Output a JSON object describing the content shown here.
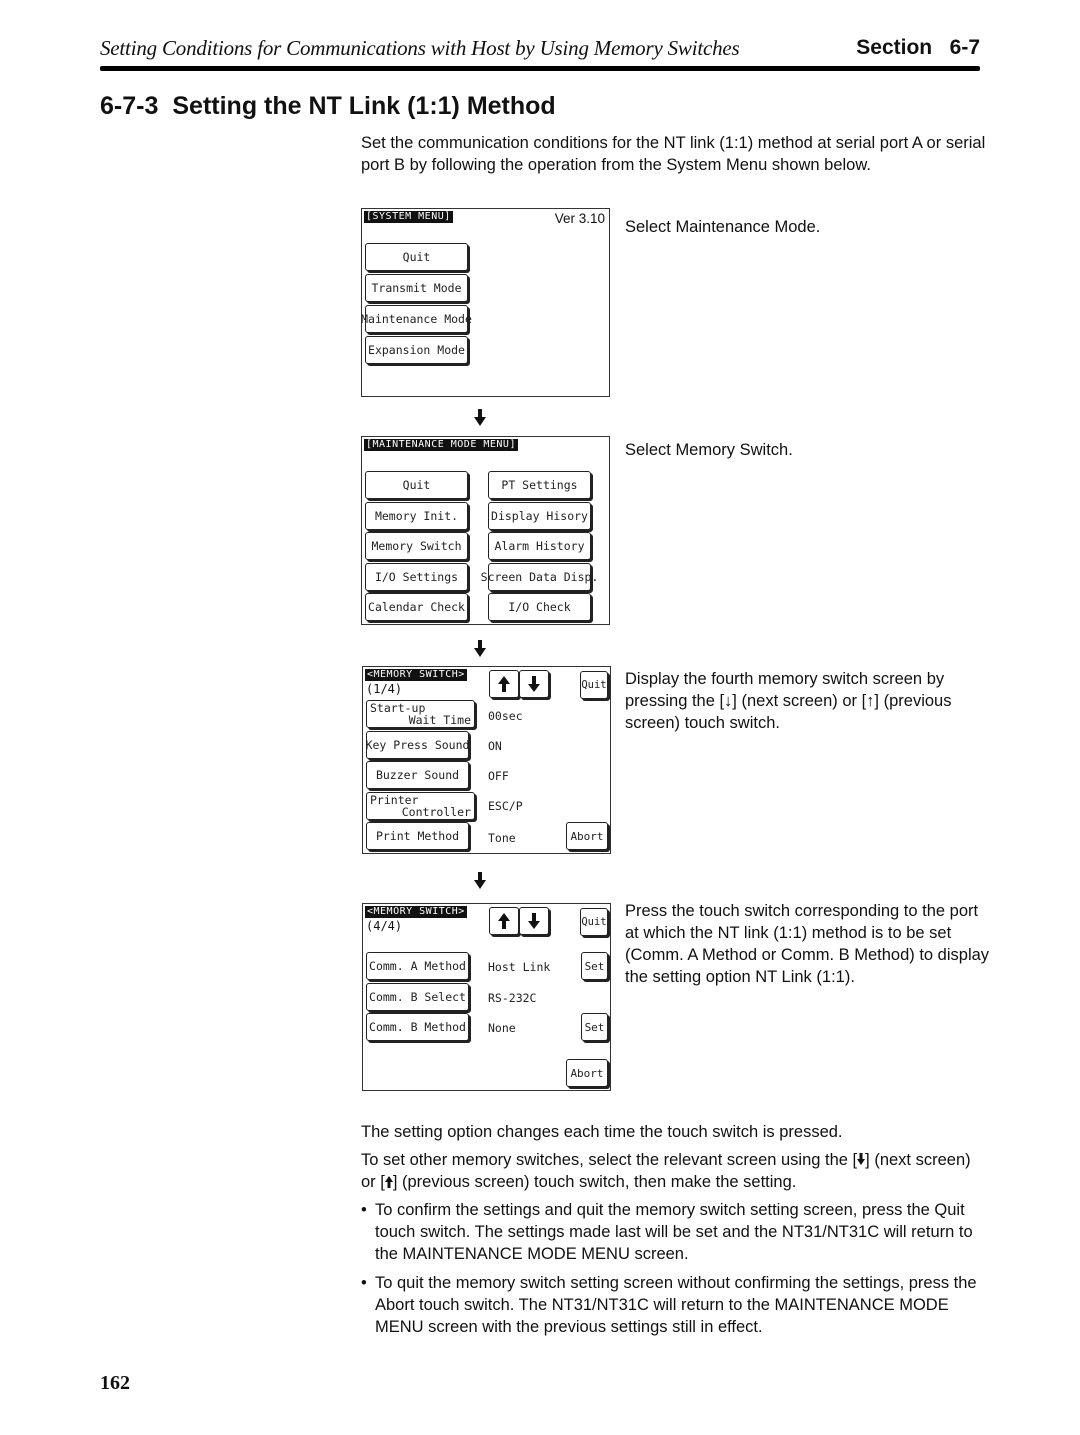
{
  "header": {
    "title": "Setting Conditions for Communications with Host by Using Memory Switches",
    "section_label": "Section",
    "section_number": "6-7"
  },
  "heading": {
    "number": "6-7-3",
    "title": "Setting the NT Link (1:1) Method"
  },
  "intro": "Set the communication conditions for the NT link (1:1) method at serial port A or serial port B by following the operation from the System Menu shown below.",
  "screens": {
    "system_menu": {
      "title": "[SYSTEM MENU]",
      "version": "Ver 3.10",
      "buttons": [
        "Quit",
        "Transmit Mode",
        "Maintenance Mode",
        "Expansion Mode"
      ],
      "caption": "Select Maintenance Mode."
    },
    "maintenance_menu": {
      "title": "[MAINTENANCE MODE MENU]",
      "left_buttons": [
        "Quit",
        "Memory Init.",
        "Memory Switch",
        "I/O Settings",
        "Calendar Check"
      ],
      "right_buttons": [
        "PT Settings",
        "Display Hisory",
        "Alarm History",
        "Screen Data Disp.",
        "I/O Check"
      ],
      "caption": "Select Memory Switch."
    },
    "memory_switch_1": {
      "title": "<MEMORY SWITCH>",
      "page": "(1/4)",
      "quit": "Quit",
      "abort": "Abort",
      "rows": [
        {
          "label_l1": "Start-up",
          "label_l2": "Wait Time",
          "value": "00sec"
        },
        {
          "label": "Key Press Sound",
          "value": "ON"
        },
        {
          "label": "Buzzer Sound",
          "value": "OFF"
        },
        {
          "label_l1": "Printer",
          "label_l2": "Controller",
          "value": "ESC/P"
        },
        {
          "label": "Print Method",
          "value": "Tone"
        }
      ],
      "caption": "Display the fourth memory switch screen by pressing the [↓] (next screen) or [↑] (previous screen) touch switch."
    },
    "memory_switch_4": {
      "title": "<MEMORY SWITCH>",
      "page": "(4/4)",
      "quit": "Quit",
      "abort": "Abort",
      "set": "Set",
      "rows": [
        {
          "label": "Comm. A Method",
          "value": "Host Link",
          "has_set": true
        },
        {
          "label": "Comm. B Select",
          "value": "RS-232C",
          "has_set": false
        },
        {
          "label": "Comm. B Method",
          "value": "None",
          "has_set": true
        }
      ],
      "caption": "Press the touch switch corresponding to the port at which the NT link (1:1) method is to be set (Comm. A Method or Comm. B Method) to display the setting option NT Link (1:1)."
    }
  },
  "body": {
    "para1": "The setting option changes each time the touch switch is pressed.",
    "para2_a": "To set other memory switches, select the relevant screen using the [",
    "para2_b": "] (next screen) or [",
    "para2_c": "] (previous screen) touch switch, then make the setting.",
    "bullets": [
      "To confirm the settings and quit the memory switch setting screen, press the Quit touch switch. The settings made last will be set and the NT31/NT31C will return to the MAINTENANCE MODE MENU screen.",
      "To quit the memory switch setting screen without confirming the settings, press the Abort touch switch. The NT31/NT31C will return to the MAINTENANCE MODE MENU screen with the previous settings still in effect."
    ],
    "bullet_char": "•"
  },
  "page_number": "162"
}
